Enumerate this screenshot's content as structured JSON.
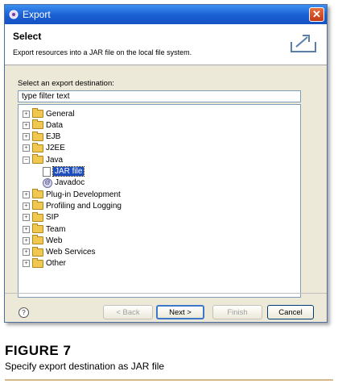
{
  "window": {
    "title": "Export",
    "close_glyph": "✕"
  },
  "banner": {
    "heading": "Select",
    "description": "Export resources into a JAR file on the local file system.",
    "icon": "export-icon"
  },
  "destination_label": "Select an export destination:",
  "filter": {
    "value": "type filter text"
  },
  "tree": [
    {
      "label": "General",
      "expanded": false
    },
    {
      "label": "Data",
      "expanded": false
    },
    {
      "label": "EJB",
      "expanded": false
    },
    {
      "label": "J2EE",
      "expanded": false
    },
    {
      "label": "Java",
      "expanded": true,
      "children": [
        "JAR file",
        "Javadoc"
      ],
      "selected_child": "JAR file"
    },
    {
      "label": "Plug-in Development",
      "expanded": false
    },
    {
      "label": "Profiling and Logging",
      "expanded": false
    },
    {
      "label": "SIP",
      "expanded": false
    },
    {
      "label": "Team",
      "expanded": false
    },
    {
      "label": "Web",
      "expanded": false
    },
    {
      "label": "Web Services",
      "expanded": false
    },
    {
      "label": "Other",
      "expanded": false
    }
  ],
  "buttons": {
    "back": "< Back",
    "next": "Next >",
    "finish": "Finish",
    "cancel": "Cancel"
  },
  "caption": {
    "title": "FIGURE 7",
    "text": "Specify export destination as JAR file"
  },
  "colors": {
    "selection": "#1f4fbf",
    "titlebar": "#1a5fd4",
    "caption_rule": "#d4b98a"
  }
}
